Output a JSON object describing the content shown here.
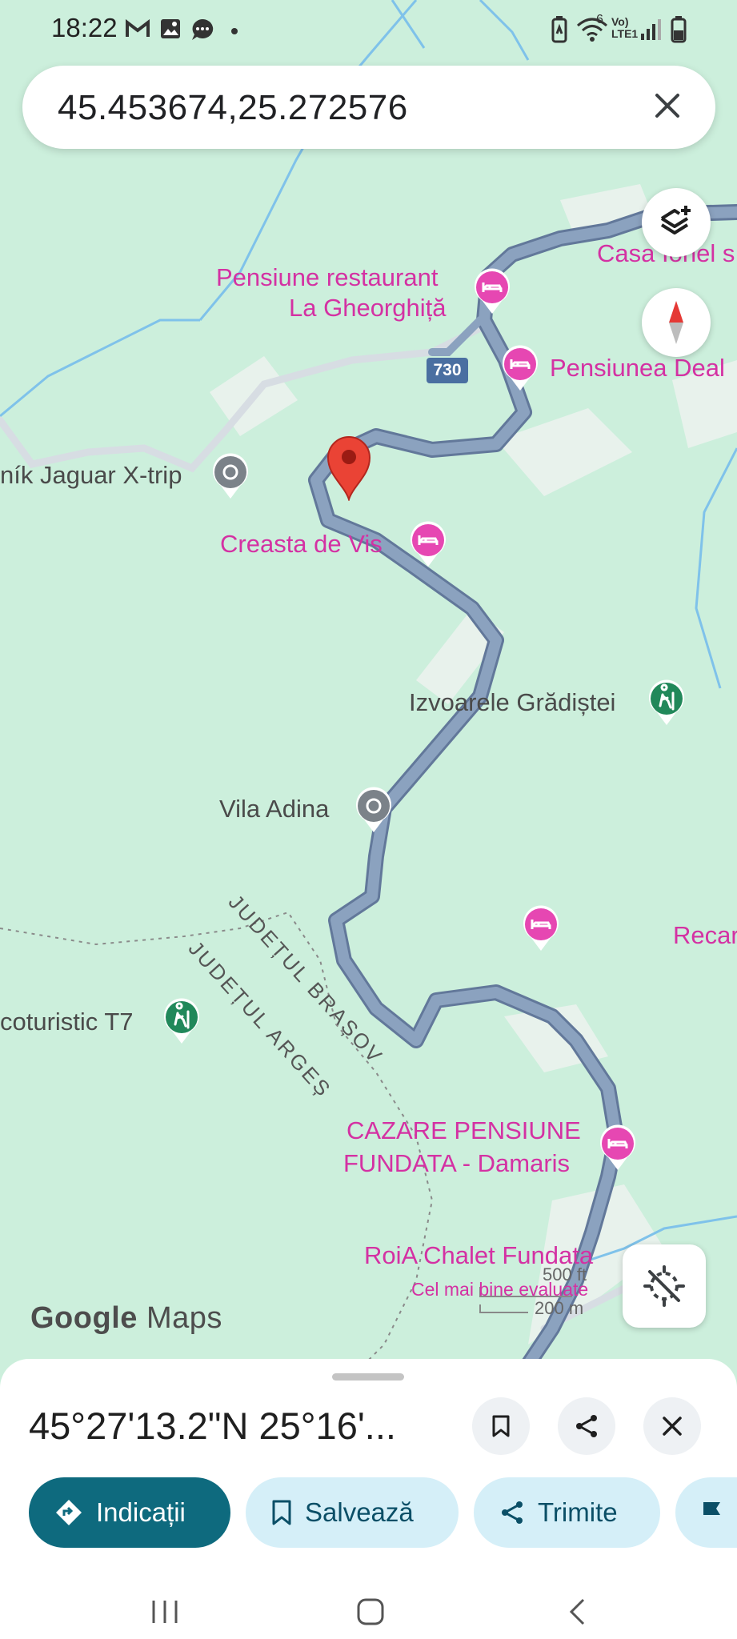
{
  "status": {
    "time": "18:22",
    "left_icons": [
      "gmail-icon",
      "gallery-icon",
      "message-icon",
      "dot-icon"
    ],
    "right_icons": [
      "battery-saver-icon",
      "wifi-icon",
      "volte-icon",
      "signal-icon",
      "battery-icon"
    ],
    "volte_text": "Vo)\nLTE1",
    "wifi_badge": "6"
  },
  "search": {
    "value": "45.453674,25.272576"
  },
  "map": {
    "road_number": "730",
    "pois": {
      "casa_ionel": "Casa Ionel s",
      "pensiune_gheorghita_1": "Pensiune restaurant",
      "pensiune_gheorghita_2": "La Gheorghiță",
      "pensiunea_deal": "Pensiunea Deal",
      "jaguar": "ník Jaguar X-trip",
      "creasta": "Creasta de Vis",
      "izvoarele": "Izvoarele Grădiștei",
      "vila_adina": "Vila Adina",
      "recar": "Recar",
      "ecoturistic": "coturistic T7",
      "cazare_1": "CAZARE PENSIUNE",
      "cazare_2": "FUNDATA - Damaris",
      "roia": "RoiA Chalet Fundata",
      "roia_sub": "Cel mai bine evaluate"
    },
    "county_brasov": "JUDEȚUL BRAȘOV",
    "county_arges": "JUDEȚUL ARGEȘ",
    "scale_ft": "500 ft",
    "scale_m": "200 m",
    "logo_google": "Google",
    "logo_maps": "Maps"
  },
  "sheet": {
    "title": "45°27'13.2\"N 25°16'...",
    "actions": {
      "directions": "Indicații",
      "save": "Salvează",
      "share": "Trimite"
    }
  },
  "colors": {
    "map_bg": "#ccefdc",
    "road": "#8ba2bf",
    "poi_pink": "#d431a3",
    "primary_btn": "#0e6a7e",
    "secondary_btn": "#d5eff8"
  }
}
